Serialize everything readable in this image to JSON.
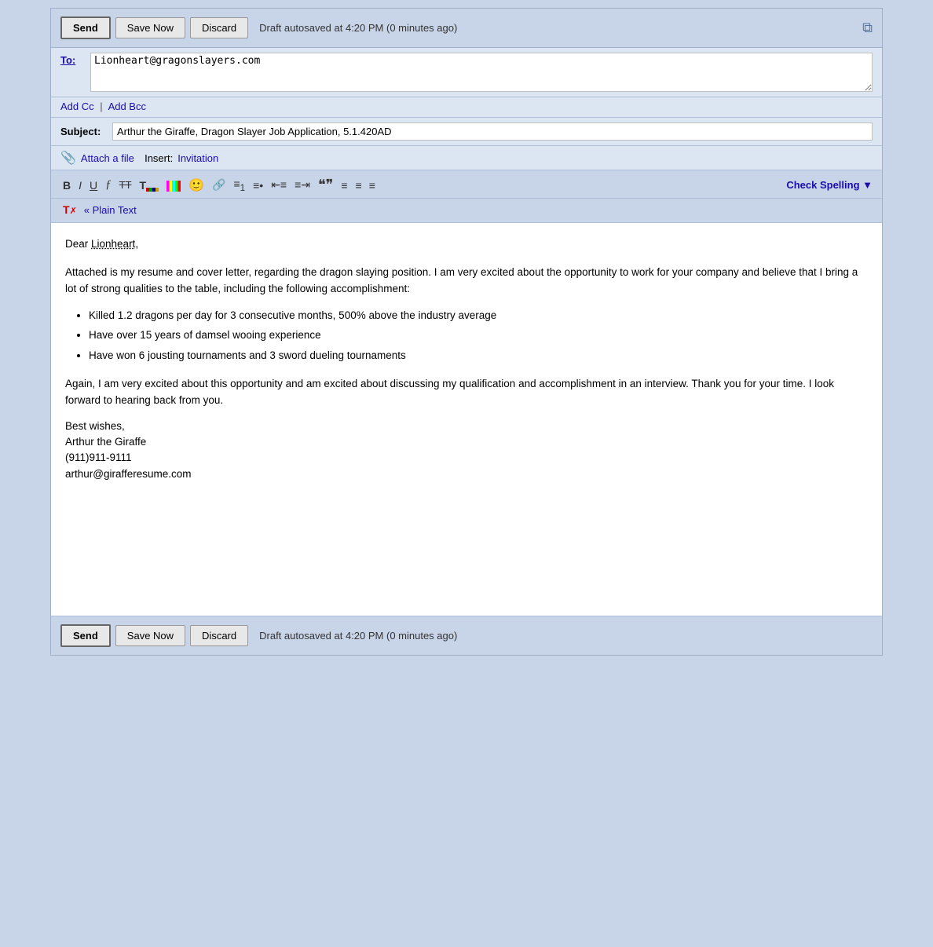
{
  "toolbar": {
    "send_label": "Send",
    "save_now_label": "Save Now",
    "discard_label": "Discard",
    "autosave_text": "Draft autosaved at 4:20 PM (0 minutes ago)",
    "check_spelling_label": "Check Spelling ▼"
  },
  "header": {
    "to_label": "To:",
    "to_value": "Lionheart@gragonslayers.com",
    "to_placeholder": "",
    "add_cc_label": "Add Cc",
    "separator": "|",
    "add_bcc_label": "Add Bcc",
    "subject_label": "Subject:",
    "subject_value": "Arthur the Giraffe, Dragon Slayer Job Application, 5.1.420AD",
    "attach_icon": "📎",
    "attach_label": "Attach a file",
    "insert_label": "Insert:",
    "invitation_label": "Invitation"
  },
  "formatting": {
    "bold": "B",
    "italic": "I",
    "underline": "U",
    "font": "𝒻",
    "strikethrough": "T̶T̶",
    "plain_text_label": "« Plain Text",
    "remove_format_label": "T✗"
  },
  "body": {
    "greeting": "Dear ",
    "name": "Lionheart",
    "comma": ",",
    "paragraph1": "Attached is my resume and cover letter, regarding the dragon slaying position.  I am very excited about the opportunity to work for your company and believe that I bring a lot of strong qualities to the table, including the following accomplishment:",
    "bullet1": "Killed 1.2 dragons per day for 3 consecutive months, 500% above the industry average",
    "bullet2": "Have over 15 years of damsel wooing experience",
    "bullet3": "Have won 6 jousting tournaments and 3 sword dueling tournaments",
    "paragraph2": "Again, I am very excited about this opportunity and am excited about discussing my qualification and accomplishment in an interview.  Thank you for your time.  I look forward to hearing back from you.",
    "sig1": "Best wishes,",
    "sig2": "Arthur the Giraffe",
    "sig3": "(911)911-9111",
    "sig4": "arthur@girafferesume.com"
  }
}
